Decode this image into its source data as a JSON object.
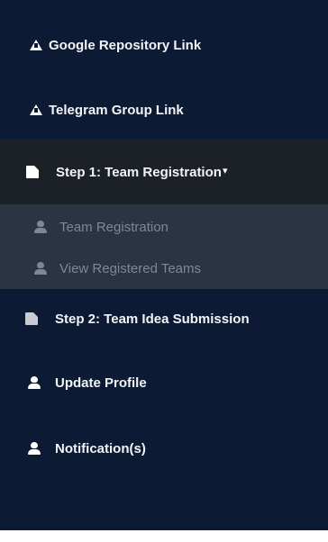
{
  "sidebar": {
    "links": {
      "google_repository": "Google Repository Link",
      "telegram_group": "Telegram Group Link"
    },
    "step1": {
      "label": "Step 1: Team Registration",
      "chevron": "▾",
      "submenu": {
        "team_registration": "Team Registration",
        "view_registered_teams": "View Registered Teams"
      }
    },
    "step2": {
      "label": "Step 2: Team Idea Submission"
    },
    "update_profile": "Update Profile",
    "notifications": "Notification(s)"
  },
  "colors": {
    "sidebar_background": "#0c1a33",
    "active_item_background": "#1c2128",
    "submenu_background": "#2a3442",
    "submenu_text": "#7c8899",
    "text": "#ffffff"
  },
  "icons": {
    "google_repository": "warning-triangle-icon",
    "telegram_group": "warning-triangle-icon",
    "step1": "document-icon",
    "step2": "document-icon",
    "submenu_items": "user-icon",
    "update_profile": "user-icon",
    "notifications": "user-icon"
  }
}
